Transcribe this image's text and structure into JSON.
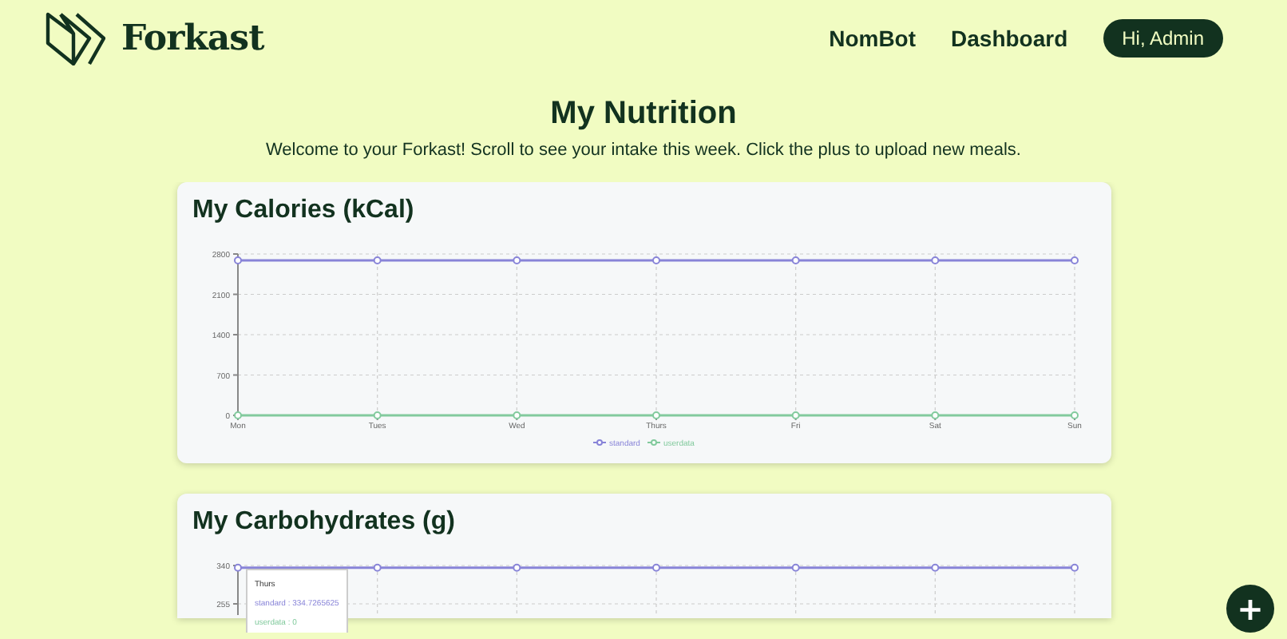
{
  "header": {
    "brand": "Forkast",
    "nav": [
      {
        "label": "NomBot"
      },
      {
        "label": "Dashboard"
      }
    ],
    "account_button": "Hi, Admin"
  },
  "page": {
    "title": "My Nutrition",
    "subtitle": "Welcome to your Forkast! Scroll to see your intake this week. Click the plus to upload new meals."
  },
  "cards": [
    {
      "title": "My Calories (kCal)",
      "chart_data": {
        "type": "line",
        "grid": true,
        "legend": true,
        "categories": [
          "Mon",
          "Tues",
          "Wed",
          "Thurs",
          "Fri",
          "Sat",
          "Sun"
        ],
        "ylim": [
          0,
          2800
        ],
        "yticks": [
          0,
          700,
          1400,
          2100,
          2800
        ],
        "series": [
          {
            "name": "standard",
            "color": "#8884d8",
            "marker": "circle",
            "values": [
              2690,
              2690,
              2690,
              2690,
              2690,
              2690,
              2690
            ]
          },
          {
            "name": "userdata",
            "color": "#82ca9d",
            "marker": "circle",
            "values": [
              0,
              0,
              0,
              0,
              0,
              0,
              0
            ]
          }
        ]
      }
    },
    {
      "title": "My Carbohydrates (g)",
      "chart_data": {
        "type": "line",
        "grid": true,
        "ylim": [
          230,
          340
        ],
        "yticks": [
          255,
          340
        ],
        "series": [
          {
            "color": "#8884d8",
            "marker": "circle",
            "values": [
              335,
              335,
              335,
              335,
              335,
              335,
              335
            ]
          }
        ]
      },
      "tooltip": {
        "title": "Thurs",
        "lines": [
          {
            "text": "standard : 334.7265625",
            "color": "#8884d8"
          },
          {
            "text": "userdata : 0",
            "color": "#82ca9d"
          }
        ]
      }
    }
  ],
  "fab": "+"
}
